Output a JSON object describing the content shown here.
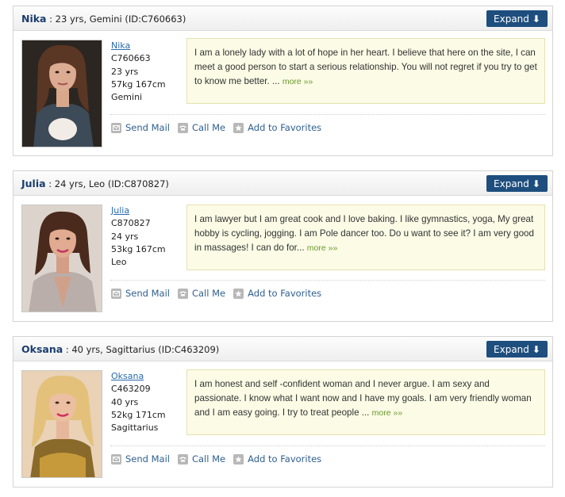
{
  "expand_label": "Expand",
  "expand_arrow": "⬇",
  "actions": {
    "send_mail": "Send Mail",
    "call_me": "Call Me",
    "add_favorites": "Add to Favorites"
  },
  "more_label": "more »»",
  "profiles": [
    {
      "name": "Nika",
      "header_rest": ": 23 yrs, Gemini (ID:C760663)",
      "id": "C760663",
      "age": "23 yrs",
      "body": "57kg 167cm",
      "sign": "Gemini",
      "bio": "I am a lonely lady with a lot of hope in her heart. I believe that here on the site, I can meet a good person to start a serious relationship. You will not regret if you try to get to know me better. ..."
    },
    {
      "name": "Julia",
      "header_rest": ": 24 yrs, Leo (ID:C870827)",
      "id": "C870827",
      "age": "24 yrs",
      "body": "53kg 167cm",
      "sign": "Leo",
      "bio": "I am lawyer but I am great cook and I love baking. I like gymnastics, yoga, My great hobby is cycling, jogging. I am Pole dancer too. Do u want to see it? I am very good in massages! I can do for..."
    },
    {
      "name": "Oksana",
      "header_rest": ": 40 yrs, Sagittarius (ID:C463209)",
      "id": "C463209",
      "age": "40 yrs",
      "body": "52kg 171cm",
      "sign": "Sagittarius",
      "bio": "I am honest and self -confident woman and I never argue. I am sexy and passionate. I know what I want now and I have my goals. I am very friendly woman and I am easy going. I try to treat people ..."
    }
  ]
}
